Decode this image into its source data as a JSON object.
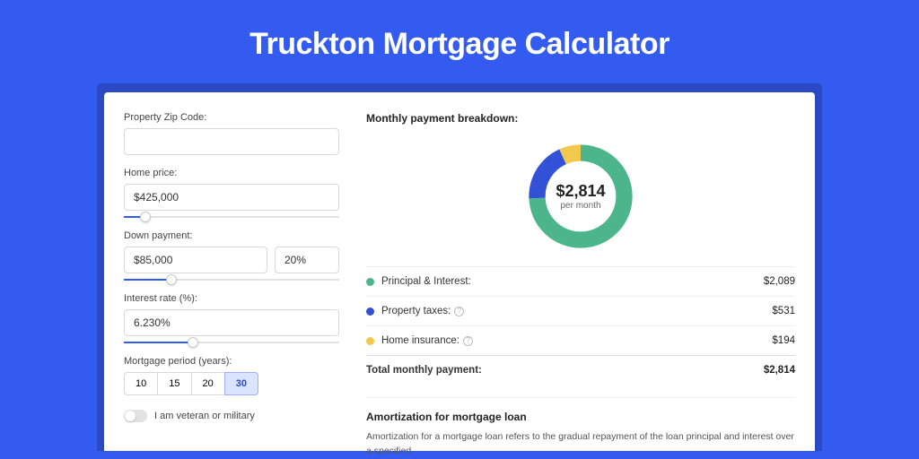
{
  "title": "Truckton Mortgage Calculator",
  "form": {
    "zip": {
      "label": "Property Zip Code:",
      "value": ""
    },
    "home_price": {
      "label": "Home price:",
      "value": "$425,000",
      "slider_pct": 10
    },
    "down_payment": {
      "label": "Down payment:",
      "amount": "$85,000",
      "percent": "20%",
      "slider_pct": 22
    },
    "interest_rate": {
      "label": "Interest rate (%):",
      "value": "6.230%",
      "slider_pct": 32
    },
    "period": {
      "label": "Mortgage period (years):",
      "options": [
        "10",
        "15",
        "20",
        "30"
      ],
      "active_index": 3
    },
    "veteran": {
      "label": "I am veteran or military",
      "checked": false
    }
  },
  "breakdown": {
    "title": "Monthly payment breakdown:",
    "center_amount": "$2,814",
    "center_sub": "per month",
    "items": [
      {
        "label": "Principal & Interest:",
        "value": "$2,089",
        "color": "#4db58b",
        "info": false,
        "fraction": 0.742
      },
      {
        "label": "Property taxes:",
        "value": "$531",
        "color": "#3351d6",
        "info": true,
        "fraction": 0.189
      },
      {
        "label": "Home insurance:",
        "value": "$194",
        "color": "#f2c94c",
        "info": true,
        "fraction": 0.069
      }
    ],
    "total": {
      "label": "Total monthly payment:",
      "value": "$2,814"
    }
  },
  "amortization": {
    "title": "Amortization for mortgage loan",
    "text": "Amortization for a mortgage loan refers to the gradual repayment of the loan principal and interest over a specified"
  },
  "chart_data": {
    "type": "pie",
    "title": "Monthly payment breakdown",
    "categories": [
      "Principal & Interest",
      "Property taxes",
      "Home insurance"
    ],
    "values": [
      2089,
      531,
      194
    ],
    "colors": [
      "#4db58b",
      "#3351d6",
      "#f2c94c"
    ],
    "total": 2814,
    "center_label": "$2,814 per month"
  }
}
